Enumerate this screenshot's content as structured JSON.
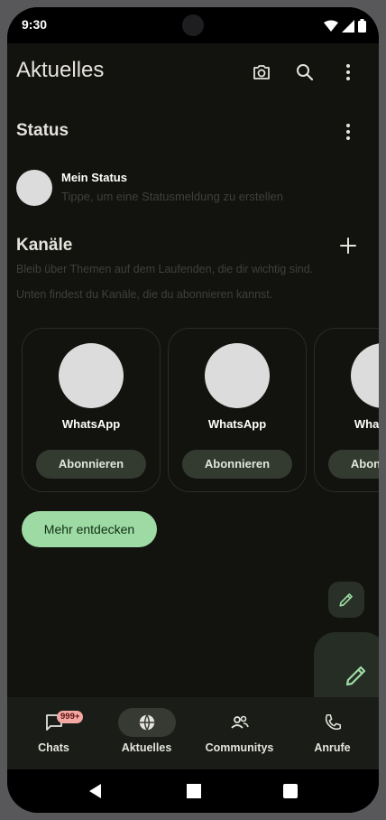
{
  "statusbar": {
    "time": "9:30"
  },
  "appbar": {
    "title": "Aktuelles",
    "icons": [
      "camera-icon",
      "search-icon",
      "more-vert-icon"
    ]
  },
  "status": {
    "title": "Status",
    "mine": {
      "name": "Mein Status",
      "subtitle": "Tippe, um eine Statusmeldung zu erstellen"
    }
  },
  "channels": {
    "title": "Kanäle",
    "desc1": "Bleib über Themen auf dem Laufenden, die dir wichtig sind.",
    "desc2": "Unten findest du Kanäle, die du abonnieren kannst.",
    "cards": [
      {
        "name": "WhatsApp",
        "button": "Abonnieren"
      },
      {
        "name": "WhatsApp",
        "button": "Abonnieren"
      },
      {
        "name": "WhatsApp",
        "button": "Abonnieren"
      }
    ],
    "discover": "Mehr entdecken"
  },
  "bottomnav": {
    "items": [
      {
        "label": "Chats",
        "icon": "chat-icon",
        "badge": "999+"
      },
      {
        "label": "Aktuelles",
        "icon": "globe-icon",
        "active": true
      },
      {
        "label": "Communitys",
        "icon": "people-icon"
      },
      {
        "label": "Anrufe",
        "icon": "phone-icon"
      }
    ]
  },
  "colors": {
    "background": "#12120e",
    "accent": "#9edba4",
    "badge": "#f4a8a4"
  }
}
